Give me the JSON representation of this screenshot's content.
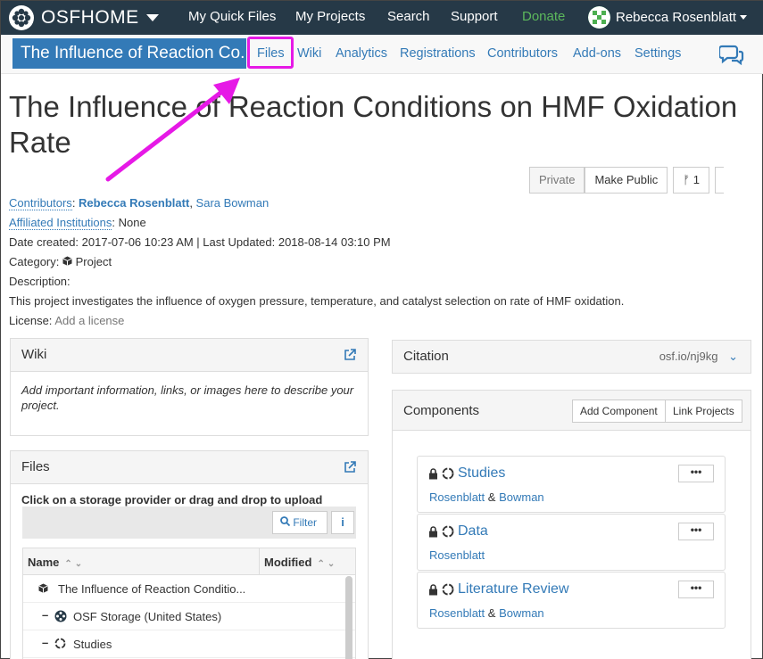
{
  "topnav": {
    "brand": "OSFHOME",
    "links": [
      "My Quick Files",
      "My Projects",
      "Search",
      "Support",
      "Donate"
    ],
    "user_name": "Rebecca Rosenblatt"
  },
  "project_nav": {
    "title": "The Influence of Reaction Co...",
    "tabs": [
      "Files",
      "Wiki",
      "Analytics",
      "Registrations",
      "Contributors",
      "Add-ons",
      "Settings"
    ]
  },
  "page_title": "The Influence of Reaction Conditions on HMF Oxidation Rate",
  "actions": {
    "private": "Private",
    "make_public": "Make Public",
    "forks": "1"
  },
  "meta": {
    "contributors_label": "Contributors",
    "contributor_1": "Rebecca Rosenblatt",
    "contributor_2": "Sara Bowman",
    "affiliated_label": "Affiliated Institutions",
    "affiliated_value": "None",
    "dates": "Date created: 2017-07-06 10:23 AM | Last Updated: 2018-08-14 03:10 PM",
    "category_label": "Category:",
    "category_value": "Project",
    "description_label": "Description:",
    "description": "This project investigates the influence of oxygen pressure, temperature, and catalyst selection on rate of HMF oxidation.",
    "license_label": "License:",
    "license_value": "Add a license"
  },
  "wiki": {
    "title": "Wiki",
    "placeholder": "Add important information, links, or images here to describe your project."
  },
  "files": {
    "title": "Files",
    "subtitle": "Click on a storage provider or drag and drop to upload",
    "filter": "Filter",
    "info": "i",
    "col_name": "Name",
    "col_modified": "Modified",
    "rows": [
      "The Influence of Reaction Conditio...",
      "OSF Storage (United States)",
      "Studies"
    ]
  },
  "citation": {
    "title": "Citation",
    "url": "osf.io/nj9kg"
  },
  "components": {
    "title": "Components",
    "add": "Add Component",
    "link": "Link Projects",
    "items": [
      {
        "title": "Studies",
        "author1": "Rosenblatt",
        "amp": "&",
        "author2": "Bowman"
      },
      {
        "title": "Data",
        "author1": "Rosenblatt",
        "amp": "",
        "author2": ""
      },
      {
        "title": "Literature Review",
        "author1": "Rosenblatt",
        "amp": "&",
        "author2": "Bowman"
      }
    ],
    "menu": "•••"
  },
  "colors": {
    "topnav": "#263947",
    "accent": "#337ab7",
    "highlight": "#e619e6",
    "donate": "#5cb85c"
  }
}
